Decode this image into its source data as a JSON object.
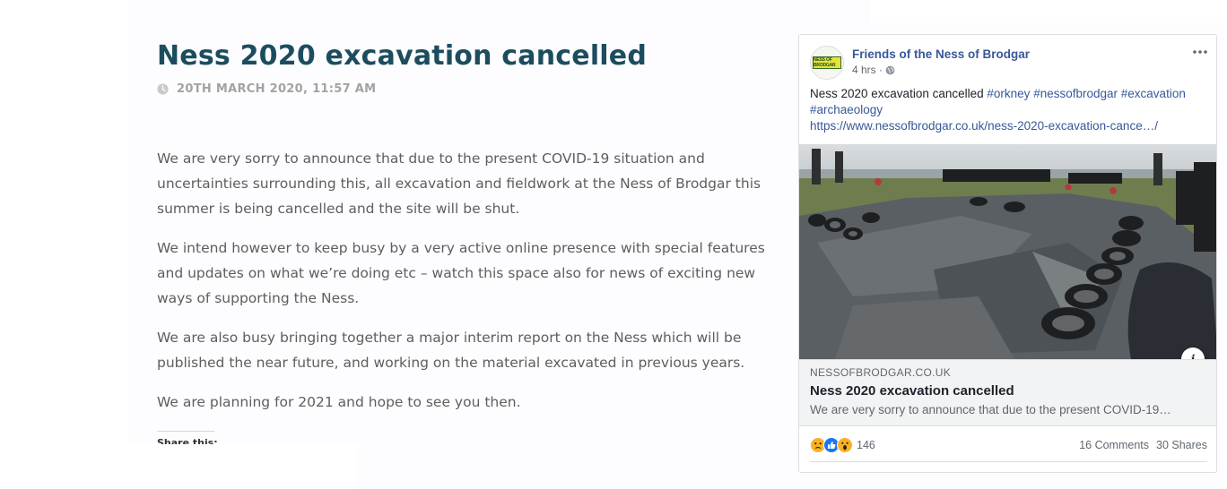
{
  "article": {
    "title": "Ness 2020 excavation cancelled",
    "date": "20TH MARCH 2020, 11:57 AM",
    "paragraphs": [
      "We are very sorry to announce that due to the present COVID-19 situation and uncertainties surrounding this, all excavation and fieldwork at the Ness of Brodgar this summer is being cancelled and the site will be shut.",
      "We intend however to keep busy by a very active online presence with special features and updates on what we’re doing etc – watch this space also for news of exciting new ways of supporting the Ness.",
      "We are also busy bringing together a major interim report on the Ness which will be published the near future, and working on the material excavated in previous years.",
      "We are planning for 2021 and hope to see you then."
    ],
    "share_label": "Share this:"
  },
  "facebook_post": {
    "avatar_text": "NESS OF BRODGAR",
    "page_name": "Friends of the Ness of Brodgar",
    "time": "4 hrs ·",
    "more_label": "•••",
    "text_intro": "Ness 2020 excavation cancelled",
    "hashtags": [
      "#orkney",
      "#nessofbrodgar",
      "#excavation",
      "#archaeology"
    ],
    "link_text": "https://www.nessofbrodgar.co.uk/ness-2020-excavation-cance…/",
    "link_preview": {
      "domain": "NESSOFBRODGAR.CO.UK",
      "title": "Ness 2020 excavation cancelled",
      "description": "We are very sorry to announce that due to the present COVID-19…"
    },
    "info_label": "i",
    "reactions": [
      "sad-icon",
      "like-icon",
      "wow-icon"
    ],
    "reaction_count": "146",
    "comments": "16 Comments",
    "shares": "30 Shares"
  },
  "colors": {
    "title": "#1c4d5e",
    "meta": "#a3a3a3",
    "fb_link": "#385898",
    "body_text": "#5e5e5e"
  }
}
